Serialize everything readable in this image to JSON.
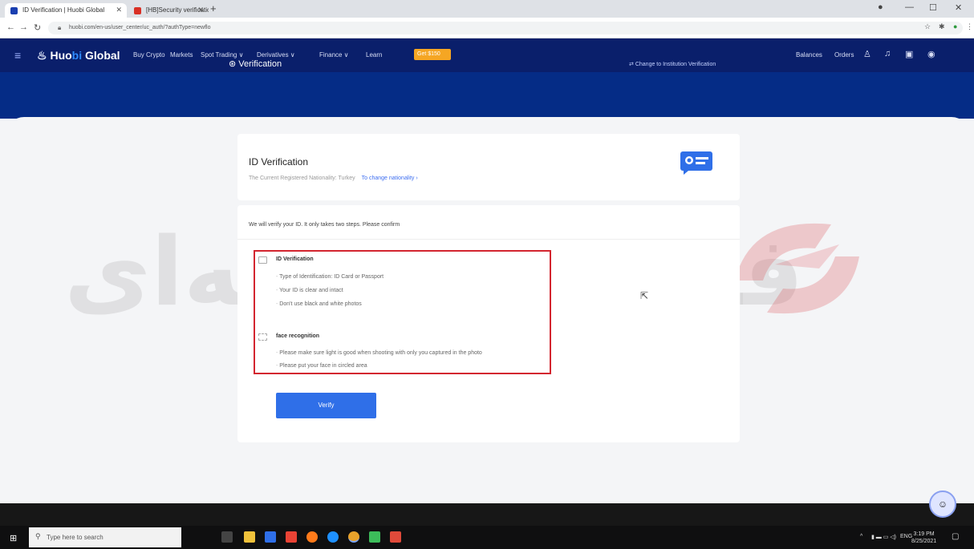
{
  "browser": {
    "tabs": [
      {
        "label": "ID Verification | Huobi Global",
        "active": true
      },
      {
        "label": "[HB]Security verification - phar",
        "active": false
      }
    ],
    "new_tab": "+",
    "url": "huobi.com/en-us/user_center/uc_auth/?authType=newflo",
    "window_controls": [
      "—",
      "☐",
      "✕"
    ]
  },
  "topnav": {
    "logo_prefix": "Huo",
    "logo_accent": "bi",
    "logo_suffix": " Global",
    "items": [
      "Buy Crypto",
      "Markets",
      "Spot Trading ∨",
      "Derivatives ∨",
      "Finance ∨",
      "Learn"
    ],
    "promo": "Get $150",
    "right_items": [
      "Balances",
      "Orders"
    ]
  },
  "header": {
    "title": "Verification",
    "institution_link": "Change to Institution Verification"
  },
  "id_card": {
    "title": "ID Verification",
    "nationality_text": "The Current Registered Nationality: Turkey",
    "change_link": "To change nationality ›"
  },
  "main_card": {
    "intro": "We will verify your ID. It only takes two steps. Please confirm",
    "sections": [
      {
        "title": "ID Verification",
        "bullets": [
          "Type of Identification: ID Card or Passport",
          "Your ID is clear and intact",
          "Don't use black and white photos"
        ]
      },
      {
        "title": "face recognition",
        "bullets": [
          "Please make sure light is good when shooting with only you captured in the photo",
          "Please put your face in circled area"
        ]
      }
    ],
    "verify_button": "Verify"
  },
  "watermark": {
    "text": "فارکس حرفه‌ای"
  },
  "taskbar": {
    "search_placeholder": "Type here to search",
    "tray_lang": "ENG",
    "time": "3:19 PM",
    "date": "8/25/2021"
  },
  "colors": {
    "header_bg": "#052c86",
    "accent": "#2f6fe8",
    "highlight": "#d3252f"
  }
}
